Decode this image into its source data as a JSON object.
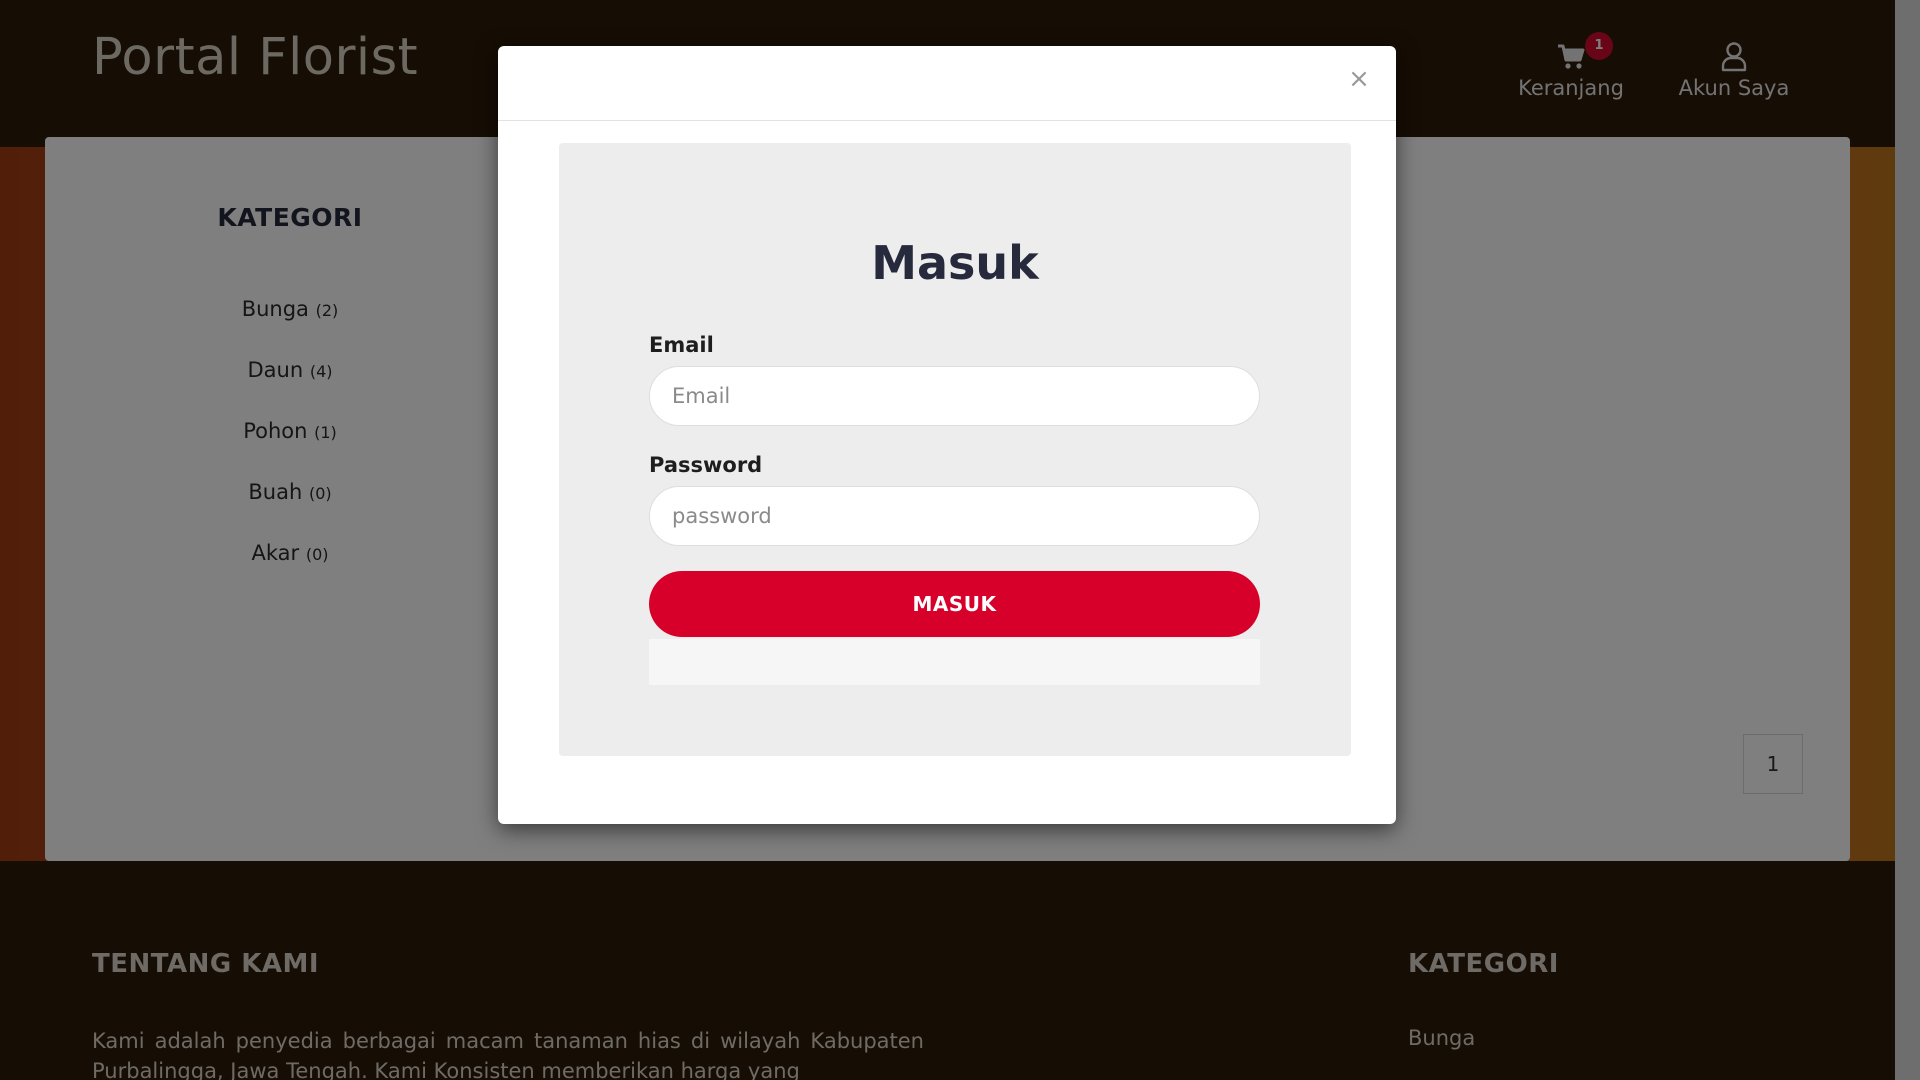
{
  "header": {
    "brand": "Portal Florist",
    "cart_label": "Keranjang",
    "cart_count": "1",
    "account_label": "Akun Saya"
  },
  "sidebar": {
    "title": "KATEGORI",
    "items": [
      {
        "label": "Bunga",
        "count": "(2)"
      },
      {
        "label": "Daun",
        "count": "(4)"
      },
      {
        "label": "Pohon",
        "count": "(1)"
      },
      {
        "label": "Buah",
        "count": "(0)"
      },
      {
        "label": "Akar",
        "count": "(0)"
      }
    ]
  },
  "pagination": {
    "current": "1"
  },
  "modal": {
    "close": "×",
    "title": "Masuk",
    "email_label": "Email",
    "email_placeholder": "Email",
    "email_value": "",
    "password_label": "Password",
    "password_placeholder": "password",
    "password_value": "",
    "submit_label": "MASUK"
  },
  "footer": {
    "about_title": "TENTANG KAMI",
    "about_text": "Kami adalah penyedia berbagai macam tanaman hias di wilayah Kabupaten Purbalingga, Jawa Tengah. Kami Konsisten memberikan harga yang",
    "category_title": "KATEGORI",
    "category_first": "Bunga"
  },
  "colors": {
    "header_bg": "#2c1a08",
    "accent": "#d6002a",
    "hero_gradient_start": "#a23d14",
    "hero_gradient_end": "#c0741e",
    "title_text": "#272a3c"
  },
  "icons": [
    "cart-icon",
    "user-icon",
    "close-icon"
  ]
}
